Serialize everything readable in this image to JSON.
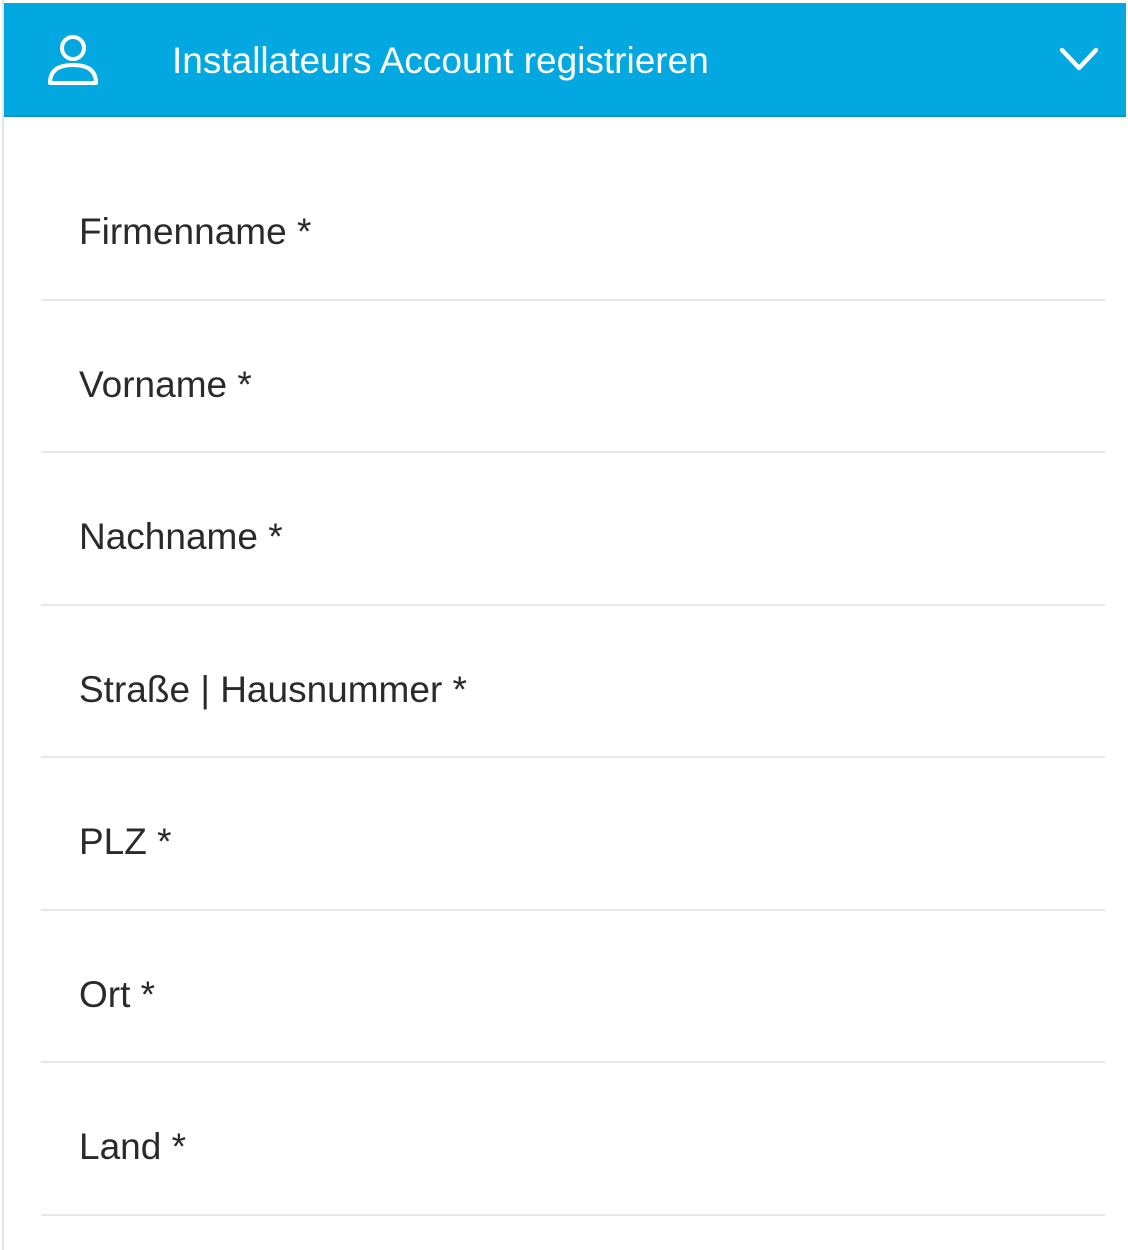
{
  "header": {
    "title": "Installateurs Account registrieren",
    "icon_left": "user-icon",
    "icon_right": "chevron-down-icon",
    "background_color": "#02a8df"
  },
  "form": {
    "fields": [
      {
        "label": "Firmenname *"
      },
      {
        "label": "Vorname *"
      },
      {
        "label": "Nachname *"
      },
      {
        "label": "Straße | Hausnummer *"
      },
      {
        "label": "PLZ *"
      },
      {
        "label": "Ort *"
      },
      {
        "label": "Land *"
      }
    ]
  }
}
